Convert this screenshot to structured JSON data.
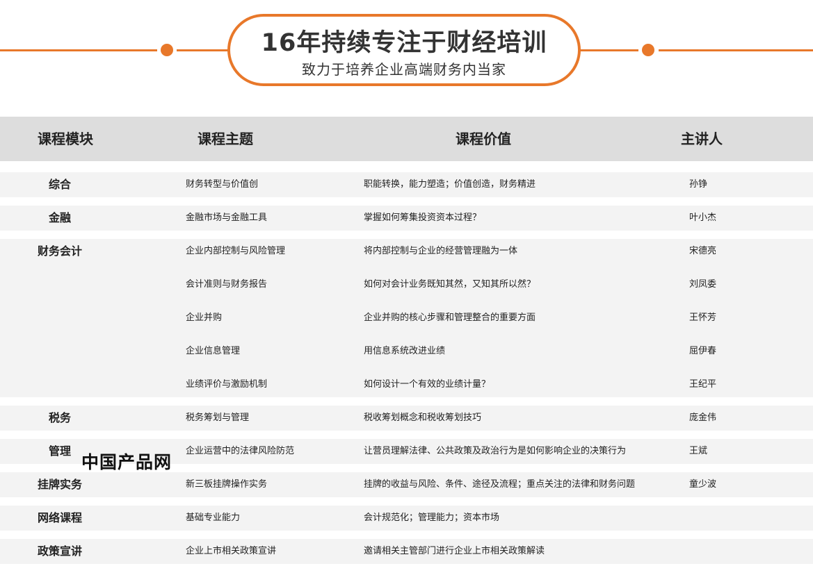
{
  "banner": {
    "title": "16年持续专注于财经培训",
    "subtitle": "致力于培养企业高端财务内当家"
  },
  "table": {
    "headers": {
      "module": "课程模块",
      "topic": "课程主题",
      "value": "课程价值",
      "lecturer": "主讲人"
    },
    "groups": [
      {
        "module": "综合",
        "rows": [
          {
            "topic": "财务转型与价值创",
            "value": "职能转换，能力塑造；价值创造，财务精进",
            "lecturer": "孙铮"
          }
        ]
      },
      {
        "module": "金融",
        "rows": [
          {
            "topic": "金融市场与金融工具",
            "value": "掌握如何筹集投资资本过程？",
            "lecturer": "叶小杰"
          }
        ]
      },
      {
        "module": "财务会计",
        "rows": [
          {
            "topic": "企业内部控制与风险管理",
            "value": "将内部控制与企业的经营管理融为一体",
            "lecturer": "宋德亮"
          },
          {
            "topic": "会计准则与财务报告",
            "value": "如何对会计业务既知其然，又知其所以然？",
            "lecturer": "刘凤委"
          },
          {
            "topic": "企业并购",
            "value": "企业并购的核心步骤和管理整合的重要方面",
            "lecturer": "王怀芳"
          },
          {
            "topic": "企业信息管理",
            "value": "用信息系统改进业绩",
            "lecturer": "屈伊春"
          },
          {
            "topic": "业绩评价与激励机制",
            "value": "如何设计一个有效的业绩计量？",
            "lecturer": "王纪平"
          }
        ]
      },
      {
        "module": "税务",
        "rows": [
          {
            "topic": "税务筹划与管理",
            "value": "税收筹划概念和税收筹划技巧",
            "lecturer": "庞金伟"
          }
        ]
      },
      {
        "module": "管理",
        "rows": [
          {
            "topic": "企业运营中的法律风险防范",
            "value": "让营员理解法律、公共政策及政治行为是如何影响企业的决策行为",
            "lecturer": "王斌"
          }
        ]
      },
      {
        "module": "挂牌实务",
        "rows": [
          {
            "topic": "新三板挂牌操作实务",
            "value": "挂牌的收益与风险、条件、途径及流程；重点关注的法律和财务问题",
            "lecturer": "童少波"
          }
        ]
      },
      {
        "module": "网络课程",
        "rows": [
          {
            "topic": "基础专业能力",
            "value": "会计规范化；管理能力；资本市场",
            "lecturer": ""
          }
        ]
      },
      {
        "module": "政策宣讲",
        "rows": [
          {
            "topic": "企业上市相关政策宣讲",
            "value": "邀请相关主管部门进行企业上市相关政策解读",
            "lecturer": ""
          }
        ]
      }
    ]
  },
  "watermark": "中国产品网",
  "colors": {
    "accent": "#e8782a",
    "header_bg": "#dddddd",
    "band_bg": "#f3f3f3"
  }
}
